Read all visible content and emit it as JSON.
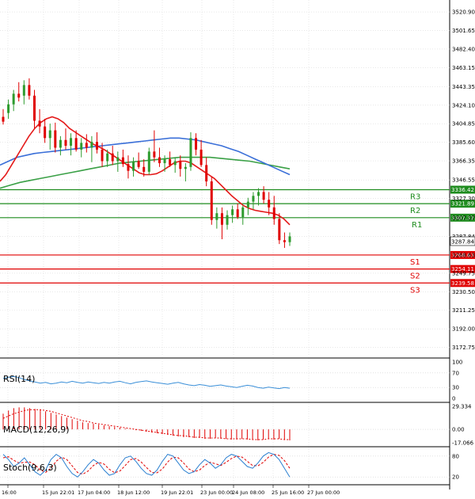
{
  "colors": {
    "bull": "#2e9b2e",
    "bear": "#e00000",
    "ma_fast": "#e41a1a",
    "ma_mid": "#3a6fd8",
    "ma_slow": "#3aa046",
    "resistance": "#1e8c1e",
    "support": "#e00000",
    "rsi": "#3a8fd8",
    "macd_hist": "#e00000",
    "stoch_k": "#2a7fd0",
    "stoch_d": "#e00000"
  },
  "main_axis": {
    "labels": [
      "3520.90",
      "3501.65",
      "3482.40",
      "3463.15",
      "3443.35",
      "3424.10",
      "3404.85",
      "3385.60",
      "3366.35",
      "3346.55",
      "3327.30",
      "3307.37",
      "3287.84",
      "3268.63",
      "3249.75",
      "3230.50",
      "3211.25",
      "3192.00",
      "3172.75"
    ],
    "ylim": [
      3165,
      3530
    ]
  },
  "levels": [
    {
      "name": "R3",
      "value": 3336.42,
      "label": "3336.42",
      "type": "resistance"
    },
    {
      "name": "R2",
      "value": 3321.89,
      "label": "3321.89",
      "type": "resistance"
    },
    {
      "name": "R1",
      "value": 3307.37,
      "label": "3307.37",
      "type": "resistance"
    },
    {
      "name": "S1",
      "value": 3268.63,
      "label": "3268.63",
      "type": "support"
    },
    {
      "name": "S2",
      "value": 3254.11,
      "label": "3254.11",
      "type": "support"
    },
    {
      "name": "S3",
      "value": 3239.58,
      "label": "3239.58",
      "type": "support"
    }
  ],
  "current_price": {
    "value": 3287.84,
    "label": "3287.84"
  },
  "x_labels": [
    "16:00",
    "15 Jun 22:01",
    "17 Jun 04:00",
    "18 Jun 12:00",
    "19 Jun 22:01",
    "23 Jun 00:00",
    "24 Jun 08:00",
    "25 Jun 16:00",
    "27 Jun 00:00"
  ],
  "rsi": {
    "title": "RSI(14)",
    "ticks": [
      "100",
      "70",
      "30",
      "0"
    ]
  },
  "macd": {
    "title": "MACD(12,26,9)",
    "ticks": [
      "29.334",
      "0.00",
      "-17.066"
    ]
  },
  "stoch": {
    "title": "Stoch(9,6,3)",
    "ticks": [
      "80",
      "20"
    ]
  },
  "chart_data": {
    "type": "candlestick",
    "ylim": [
      3165,
      3530
    ],
    "candles": [
      [
        3412,
        3420,
        3404,
        3407
      ],
      [
        3416,
        3430,
        3410,
        3425
      ],
      [
        3425,
        3440,
        3418,
        3436
      ],
      [
        3436,
        3448,
        3428,
        3432
      ],
      [
        3434,
        3450,
        3425,
        3445
      ],
      [
        3445,
        3452,
        3430,
        3434
      ],
      [
        3434,
        3440,
        3400,
        3408
      ],
      [
        3408,
        3420,
        3395,
        3402
      ],
      [
        3402,
        3410,
        3385,
        3390
      ],
      [
        3390,
        3405,
        3378,
        3398
      ],
      [
        3398,
        3406,
        3375,
        3380
      ],
      [
        3380,
        3392,
        3372,
        3388
      ],
      [
        3388,
        3400,
        3378,
        3382
      ],
      [
        3382,
        3395,
        3372,
        3390
      ],
      [
        3390,
        3398,
        3376,
        3378
      ],
      [
        3378,
        3390,
        3370,
        3385
      ],
      [
        3385,
        3394,
        3375,
        3380
      ],
      [
        3380,
        3392,
        3365,
        3386
      ],
      [
        3386,
        3396,
        3374,
        3378
      ],
      [
        3378,
        3385,
        3360,
        3366
      ],
      [
        3366,
        3378,
        3360,
        3374
      ],
      [
        3374,
        3382,
        3362,
        3366
      ],
      [
        3366,
        3376,
        3355,
        3370
      ],
      [
        3370,
        3378,
        3360,
        3363
      ],
      [
        3363,
        3372,
        3348,
        3356
      ],
      [
        3356,
        3370,
        3350,
        3366
      ],
      [
        3366,
        3375,
        3358,
        3360
      ],
      [
        3360,
        3368,
        3350,
        3355
      ],
      [
        3355,
        3380,
        3352,
        3376
      ],
      [
        3376,
        3398,
        3365,
        3370
      ],
      [
        3370,
        3380,
        3360,
        3364
      ],
      [
        3364,
        3372,
        3355,
        3368
      ],
      [
        3368,
        3376,
        3360,
        3362
      ],
      [
        3362,
        3370,
        3354,
        3366
      ],
      [
        3366,
        3372,
        3350,
        3358
      ],
      [
        3358,
        3364,
        3345,
        3360
      ],
      [
        3360,
        3396,
        3356,
        3390
      ],
      [
        3390,
        3395,
        3372,
        3378
      ],
      [
        3378,
        3388,
        3360,
        3362
      ],
      [
        3362,
        3370,
        3340,
        3345
      ],
      [
        3345,
        3350,
        3300,
        3305
      ],
      [
        3305,
        3318,
        3296,
        3312
      ],
      [
        3312,
        3318,
        3285,
        3300
      ],
      [
        3300,
        3315,
        3295,
        3310
      ],
      [
        3310,
        3320,
        3302,
        3316
      ],
      [
        3316,
        3322,
        3306,
        3308
      ],
      [
        3308,
        3320,
        3300,
        3318
      ],
      [
        3318,
        3328,
        3310,
        3324
      ],
      [
        3324,
        3334,
        3316,
        3330
      ],
      [
        3330,
        3338,
        3320,
        3334
      ],
      [
        3334,
        3340,
        3322,
        3326
      ],
      [
        3326,
        3334,
        3310,
        3318
      ],
      [
        3318,
        3330,
        3300,
        3306
      ],
      [
        3306,
        3312,
        3280,
        3284
      ],
      [
        3284,
        3292,
        3276,
        3282
      ],
      [
        3282,
        3292,
        3278,
        3288
      ]
    ],
    "ma_fast": [
      3345,
      3352,
      3362,
      3372,
      3382,
      3392,
      3400,
      3406,
      3410,
      3412,
      3410,
      3406,
      3400,
      3396,
      3392,
      3388,
      3384,
      3381,
      3378,
      3374,
      3370,
      3366,
      3362,
      3358,
      3354,
      3352,
      3352,
      3353,
      3356,
      3360,
      3364,
      3366,
      3366,
      3364,
      3360,
      3356,
      3352,
      3348,
      3342,
      3336,
      3330,
      3325,
      3320,
      3317,
      3315,
      3314,
      3313,
      3312,
      3310,
      3306,
      3300
    ],
    "ma_mid": [
      3362,
      3366,
      3370,
      3372,
      3374,
      3375,
      3376,
      3377,
      3378,
      3379,
      3380,
      3381,
      3382,
      3383,
      3384,
      3385,
      3386,
      3387,
      3388,
      3389,
      3390,
      3390,
      3389,
      3388,
      3386,
      3384,
      3382,
      3379,
      3376,
      3372,
      3368,
      3364,
      3360,
      3356,
      3352
    ],
    "ma_slow": [
      3338,
      3341,
      3344,
      3346,
      3348,
      3350,
      3352,
      3354,
      3356,
      3358,
      3360,
      3362,
      3364,
      3365,
      3366,
      3367,
      3368,
      3369,
      3370,
      3370,
      3370,
      3370,
      3369,
      3368,
      3367,
      3366,
      3364,
      3362,
      3360,
      3358
    ],
    "rsi": [
      55,
      58,
      60,
      57,
      52,
      48,
      45,
      42,
      44,
      40,
      42,
      45,
      43,
      47,
      44,
      42,
      45,
      43,
      41,
      44,
      42,
      45,
      47,
      43,
      40,
      44,
      46,
      48,
      45,
      43,
      41,
      39,
      42,
      44,
      40,
      37,
      35,
      38,
      36,
      33,
      35,
      37,
      34,
      32,
      30,
      33,
      36,
      34,
      30,
      28,
      31,
      29,
      27,
      30,
      28
    ],
    "macd": [
      20,
      24,
      27,
      28,
      28,
      27,
      26,
      25,
      23,
      21,
      19,
      17,
      15,
      13,
      11,
      9,
      8,
      7,
      6,
      5,
      4,
      3,
      2,
      1,
      0,
      -1,
      -2,
      -3,
      -4,
      -5,
      -6,
      -7,
      -8,
      -9,
      -10,
      -10,
      -11,
      -11,
      -12,
      -12,
      -11,
      -12,
      -12,
      -13,
      -13,
      -12,
      -13,
      -13,
      -14,
      -13,
      -12,
      -13,
      -12,
      -13,
      -14
    ],
    "macd_signal": [
      14,
      17,
      20,
      22,
      24,
      25,
      25,
      25,
      24,
      23,
      21,
      19,
      17,
      15,
      13,
      11,
      10,
      8,
      7,
      6,
      5,
      4,
      3,
      2,
      1,
      0,
      -1,
      -2,
      -3,
      -4,
      -5,
      -6,
      -7,
      -8,
      -8,
      -9,
      -10,
      -10,
      -11,
      -11,
      -11,
      -11,
      -12,
      -12,
      -12,
      -12,
      -12,
      -13,
      -13,
      -13,
      -12,
      -12,
      -12,
      -13,
      -13
    ],
    "stoch_k": [
      85,
      70,
      50,
      60,
      75,
      55,
      35,
      25,
      40,
      70,
      85,
      75,
      50,
      30,
      20,
      35,
      55,
      70,
      60,
      40,
      25,
      30,
      55,
      75,
      80,
      65,
      45,
      30,
      25,
      40,
      65,
      85,
      80,
      60,
      40,
      30,
      35,
      55,
      70,
      60,
      45,
      55,
      75,
      85,
      80,
      65,
      50,
      45,
      60,
      80,
      90,
      85,
      70,
      45,
      20
    ],
    "stoch_d": [
      75,
      78,
      68,
      60,
      62,
      63,
      55,
      40,
      33,
      45,
      65,
      77,
      70,
      52,
      33,
      28,
      37,
      53,
      62,
      57,
      42,
      32,
      37,
      53,
      70,
      73,
      63,
      47,
      33,
      32,
      43,
      63,
      77,
      75,
      60,
      43,
      35,
      40,
      53,
      62,
      58,
      53,
      62,
      73,
      80,
      77,
      65,
      53,
      52,
      62,
      77,
      85,
      82,
      67,
      45
    ]
  }
}
